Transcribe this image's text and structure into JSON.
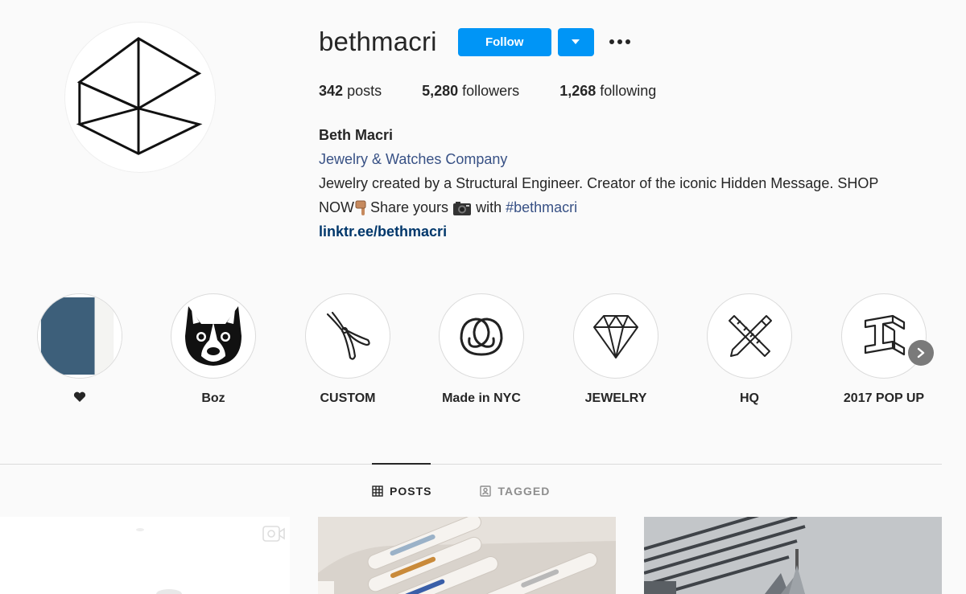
{
  "profile": {
    "username": "bethmacri",
    "follow_label": "Follow",
    "stats": {
      "posts_count": "342",
      "posts_label": "posts",
      "followers_count": "5,280",
      "followers_label": "followers",
      "following_count": "1,268",
      "following_label": "following"
    },
    "bio": {
      "name": "Beth Macri",
      "category": "Jewelry & Watches Company",
      "line1": "Jewelry created by a Structural Engineer. Creator of the iconic Hidden Message. SHOP",
      "line2_start": "NOW",
      "line2_mid": "Share yours",
      "line2_with": "with",
      "hashtag": "#bethmacri",
      "link": "linktr.ee/bethmacri"
    }
  },
  "highlights": [
    {
      "label": "",
      "icon": "heart-icon"
    },
    {
      "label": "Boz",
      "icon": "boston-terrier-icon"
    },
    {
      "label": "CUSTOM",
      "icon": "pliers-icon"
    },
    {
      "label": "Made in NYC",
      "icon": "pretzel-icon"
    },
    {
      "label": "JEWELRY",
      "icon": "diamond-icon"
    },
    {
      "label": "HQ",
      "icon": "ruler-pencil-icon"
    },
    {
      "label": "2017 POP UP",
      "icon": "steel-beam-icon"
    }
  ],
  "tabs": {
    "posts": "POSTS",
    "tagged": "TAGGED"
  },
  "colors": {
    "accent": "#0095f6",
    "link": "#00376b",
    "category": "#385185",
    "background": "#fafafa"
  }
}
